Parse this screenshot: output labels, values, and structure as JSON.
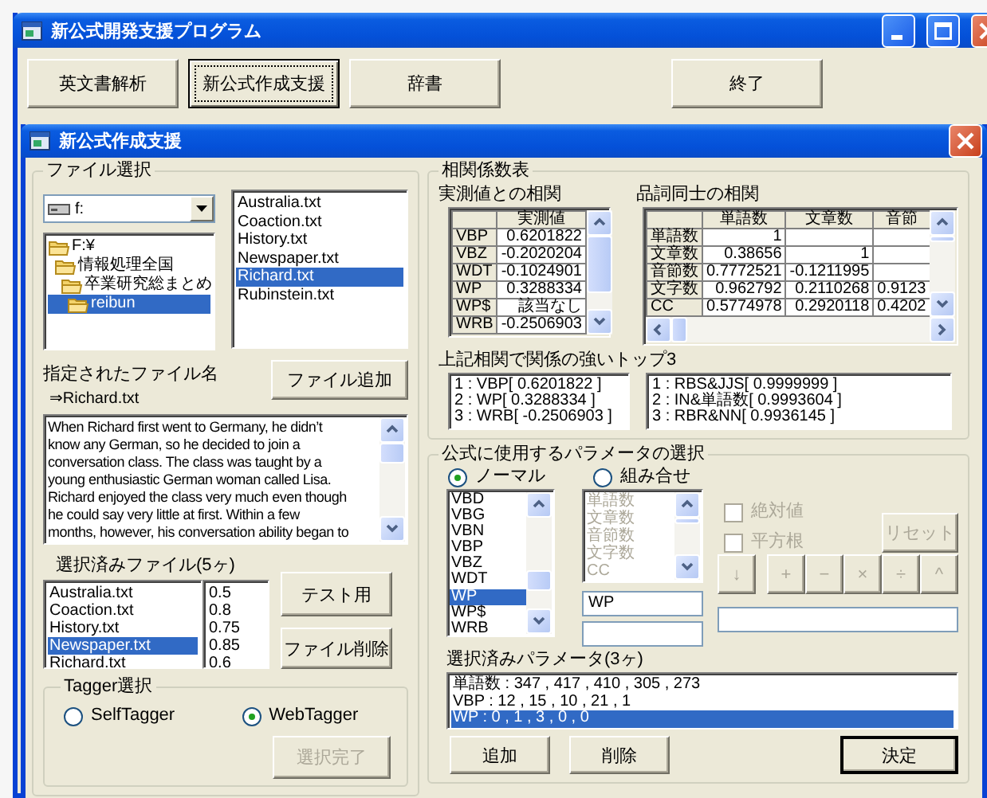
{
  "window": {
    "title": "新公式開発支援プログラム"
  },
  "toolbar": [
    {
      "label": "英文書解析",
      "focused": false
    },
    {
      "label": "新公式作成支援",
      "focused": true
    },
    {
      "label": "辞書",
      "focused": false
    },
    {
      "label": "終了",
      "focused": false
    }
  ],
  "dialog": {
    "title": "新公式作成支援"
  },
  "file_select": {
    "title": "ファイル選択",
    "drive": "f:",
    "folders": [
      {
        "label": "F:¥",
        "selected": false,
        "children": [
          {
            "label": "情報処理全国",
            "selected": false,
            "children": [
              {
                "label": "卒業研究総まとめ",
                "selected": false,
                "children": [
                  {
                    "label": "reibun",
                    "selected": true
                  }
                ]
              }
            ]
          }
        ]
      }
    ],
    "files": [
      {
        "label": "Australia.txt",
        "selected": false
      },
      {
        "label": "Coaction.txt",
        "selected": false
      },
      {
        "label": "History.txt",
        "selected": false
      },
      {
        "label": "Newspaper.txt",
        "selected": false
      },
      {
        "label": "Richard.txt",
        "selected": true
      },
      {
        "label": "Rubinstein.txt",
        "selected": false
      }
    ],
    "filename_label": "指定されたファイル名",
    "filename": "⇒Richard.txt",
    "add_button": "ファイル追加",
    "preview_lines": [
      "When Richard first went to Germany, he didn’t",
      "know any German, so he decided to join a",
      "conversation class. The class was taught by a",
      "young enthusiastic German woman called Lisa.",
      "Richard enjoyed the class very much even though",
      "he could say very little at first. Within a few",
      "months, however, his conversation ability began to"
    ],
    "selected_files_label": "選択済みファイル(5ヶ)",
    "selected_files": [
      {
        "name": "Australia.txt",
        "value": "0.5",
        "selected": false
      },
      {
        "name": "Coaction.txt",
        "value": "0.8",
        "selected": false
      },
      {
        "name": "History.txt",
        "value": "0.75",
        "selected": false
      },
      {
        "name": "Newspaper.txt",
        "value": "0.85",
        "selected": true
      },
      {
        "name": "Richard.txt",
        "value": "0.6",
        "selected": false
      }
    ],
    "test_button": "テスト用",
    "delete_button": "ファイル削除",
    "tagger": {
      "title": "Tagger選択",
      "options": [
        {
          "label": "SelfTagger",
          "selected": false
        },
        {
          "label": "WebTagger",
          "selected": true
        }
      ],
      "done_button": {
        "label": "選択完了",
        "disabled": true
      }
    }
  },
  "correlation": {
    "title": "相関係数表",
    "measured": {
      "title": "実測値との相関",
      "columns": [
        "実測値"
      ],
      "rows": [
        {
          "label": "VBP",
          "cells": [
            "0.6201822"
          ]
        },
        {
          "label": "VBZ",
          "cells": [
            "-0.2020204"
          ]
        },
        {
          "label": "WDT",
          "cells": [
            "-0.1024901"
          ]
        },
        {
          "label": "WP",
          "cells": [
            "0.3288334"
          ]
        },
        {
          "label": "WP$",
          "cells": [
            "該当なし"
          ]
        },
        {
          "label": "WRB",
          "cells": [
            "-0.2506903"
          ]
        }
      ]
    },
    "pos": {
      "title": "品詞同士の相関",
      "columns": [
        "単語数",
        "文章数",
        "音節"
      ],
      "rows": [
        {
          "label": "単語数",
          "cells": [
            "1",
            null,
            null
          ]
        },
        {
          "label": "文章数",
          "cells": [
            "0.38656",
            "1",
            null
          ]
        },
        {
          "label": "音節数",
          "cells": [
            "0.7772521",
            "-0.1211995",
            null
          ]
        },
        {
          "label": "文字数",
          "cells": [
            "0.962792",
            "0.2110268",
            "0.9123"
          ]
        },
        {
          "label": "CC",
          "cells": [
            "0.5774978",
            "0.2920118",
            "0.4202"
          ]
        }
      ]
    },
    "top3_title": "上記相関で関係の強いトップ3",
    "top3_measured": [
      "1 : VBP[ 0.6201822 ]",
      "2 : WP[ 0.3288334 ]",
      "3 : WRB[ -0.2506903 ]"
    ],
    "top3_pos": [
      "1 : RBS&JJS[ 0.9999999 ]",
      "2 : IN&単語数[ 0.9993604 ]",
      "3 : RBR&NN[ 0.9936145 ]"
    ]
  },
  "parameters": {
    "title": "公式に使用するパラメータの選択",
    "modes": [
      {
        "label": "ノーマル",
        "selected": true
      },
      {
        "label": "組み合せ",
        "selected": false
      }
    ],
    "normal_list": [
      {
        "label": "VBD",
        "selected": false
      },
      {
        "label": "VBG",
        "selected": false
      },
      {
        "label": "VBN",
        "selected": false
      },
      {
        "label": "VBP",
        "selected": false
      },
      {
        "label": "VBZ",
        "selected": false
      },
      {
        "label": "WDT",
        "selected": false
      },
      {
        "label": "WP",
        "selected": true
      },
      {
        "label": "WP$",
        "selected": false
      },
      {
        "label": "WRB",
        "selected": false
      }
    ],
    "combo_list": {
      "disabled": true,
      "items": [
        "単語数",
        "文章数",
        "音節数",
        "文字数",
        "CC"
      ]
    },
    "checkboxes": [
      {
        "label": "絶対値",
        "checked": false,
        "disabled": true
      },
      {
        "label": "平方根",
        "checked": false,
        "disabled": true
      }
    ],
    "reset_button": {
      "label": "リセット",
      "disabled": true
    },
    "operators": [
      {
        "label": "↓",
        "disabled": true
      },
      {
        "label": "+",
        "disabled": true
      },
      {
        "label": "−",
        "disabled": true
      },
      {
        "label": "×",
        "disabled": true
      },
      {
        "label": "÷",
        "disabled": true
      },
      {
        "label": "^",
        "disabled": true
      }
    ],
    "parameter_field": "WP",
    "selected_label": "選択済みパラメータ(3ヶ)",
    "selected_params": [
      {
        "label": "単語数 : 347 , 417 , 410 , 305 , 273",
        "selected": false
      },
      {
        "label": "VBP : 12 , 15 , 10 , 21 , 1",
        "selected": false
      },
      {
        "label": "WP : 0 , 1 , 3 , 0 , 0",
        "selected": true
      }
    ],
    "buttons": [
      {
        "label": "追加",
        "default": false
      },
      {
        "label": "削除",
        "default": false
      },
      {
        "label": "決定",
        "default": true
      }
    ]
  }
}
